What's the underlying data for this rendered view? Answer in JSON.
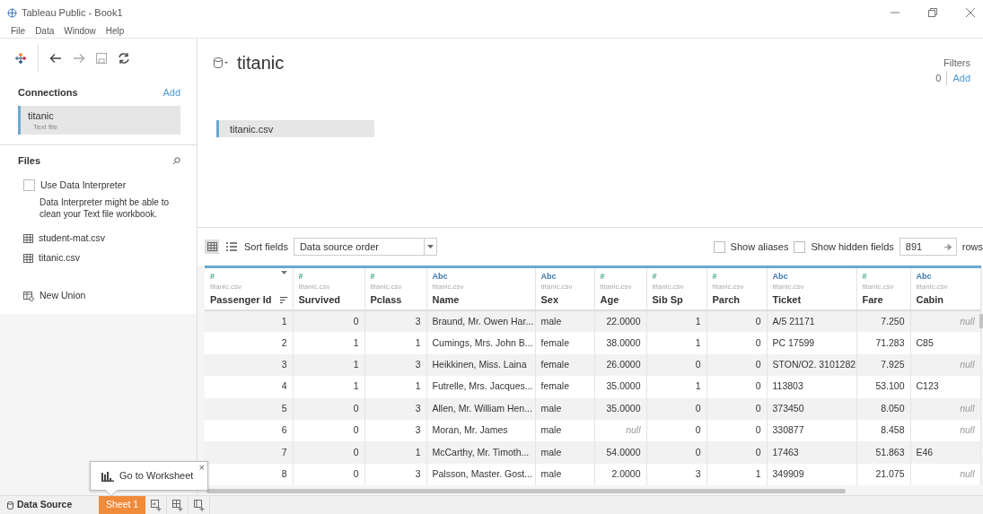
{
  "window": {
    "title": "Tableau Public - Book1"
  },
  "menu": [
    "File",
    "Data",
    "Window",
    "Help"
  ],
  "connections": {
    "title": "Connections",
    "add": "Add",
    "items": [
      {
        "name": "titanic",
        "type": "Text file",
        "selected": true
      }
    ]
  },
  "files": {
    "title": "Files",
    "interpreter": {
      "label": "Use Data Interpreter",
      "checked": false,
      "hint": "Data Interpreter might be able to clean your Text file workbook."
    },
    "items": [
      {
        "name": "student-mat.csv",
        "kind": "table"
      },
      {
        "name": "titanic.csv",
        "kind": "table"
      },
      {
        "name": "New Union",
        "kind": "union"
      }
    ]
  },
  "datasource": {
    "name": "titanic",
    "tables": [
      "titanic.csv"
    ]
  },
  "filters": {
    "label": "Filters",
    "count": "0",
    "add": "Add"
  },
  "grid_toolbar": {
    "views": [
      {
        "kind": "grid",
        "selected": true
      },
      {
        "kind": "list",
        "selected": false
      }
    ],
    "sort_label": "Sort fields",
    "sort_value": "Data source order",
    "show_aliases": {
      "label": "Show aliases",
      "checked": false
    },
    "show_hidden": {
      "label": "Show hidden fields",
      "checked": false
    },
    "row_count": "891",
    "rows_label": "rows"
  },
  "columns": [
    {
      "type_label": "#",
      "kind": "number",
      "source": "titanic.csv",
      "name": "Passenger Id",
      "sorted": true,
      "hovered": true
    },
    {
      "type_label": "#",
      "kind": "number",
      "source": "titanic.csv",
      "name": "Survived",
      "sorted": false,
      "hovered": false
    },
    {
      "type_label": "#",
      "kind": "number",
      "source": "titanic.csv",
      "name": "Pclass",
      "sorted": false,
      "hovered": false
    },
    {
      "type_label": "Abc",
      "kind": "string",
      "source": "titanic.csv",
      "name": "Name",
      "sorted": false,
      "hovered": false
    },
    {
      "type_label": "Abc",
      "kind": "string",
      "source": "titanic.csv",
      "name": "Sex",
      "sorted": false,
      "hovered": false
    },
    {
      "type_label": "#",
      "kind": "number",
      "source": "titanic.csv",
      "name": "Age",
      "sorted": false,
      "hovered": false
    },
    {
      "type_label": "#",
      "kind": "number",
      "source": "titanic.csv",
      "name": "Sib Sp",
      "sorted": false,
      "hovered": false
    },
    {
      "type_label": "#",
      "kind": "number",
      "source": "titanic.csv",
      "name": "Parch",
      "sorted": false,
      "hovered": false
    },
    {
      "type_label": "Abc",
      "kind": "string",
      "source": "titanic.csv",
      "name": "Ticket",
      "sorted": false,
      "hovered": false
    },
    {
      "type_label": "#",
      "kind": "number",
      "source": "titanic.csv",
      "name": "Fare",
      "sorted": false,
      "hovered": false
    },
    {
      "type_label": "Abc",
      "kind": "string",
      "source": "titanic.csv",
      "name": "Cabin",
      "sorted": false,
      "hovered": false
    }
  ],
  "rows": [
    {
      "cells": [
        "1",
        "0",
        "3",
        "Braund, Mr. Owen Har...",
        "male",
        "22.0000",
        "1",
        "0",
        "A/5 21171",
        "7.250",
        {
          "text": "null",
          "kind": "missing"
        }
      ]
    },
    {
      "cells": [
        "2",
        "1",
        "1",
        "Cumings, Mrs. John B...",
        "female",
        "38.0000",
        "1",
        "0",
        "PC 17599",
        "71.283",
        "C85"
      ]
    },
    {
      "cells": [
        "3",
        "1",
        "3",
        "Heikkinen, Miss. Laina",
        "female",
        "26.0000",
        "0",
        "0",
        "STON/O2. 3101282",
        "7.925",
        {
          "text": "null",
          "kind": "missing"
        }
      ]
    },
    {
      "cells": [
        "4",
        "1",
        "1",
        "Futrelle, Mrs. Jacques...",
        "female",
        "35.0000",
        "1",
        "0",
        "113803",
        "53.100",
        "C123"
      ]
    },
    {
      "cells": [
        "5",
        "0",
        "3",
        "Allen, Mr. William Hen...",
        "male",
        "35.0000",
        "0",
        "0",
        "373450",
        "8.050",
        {
          "text": "null",
          "kind": "missing"
        }
      ]
    },
    {
      "cells": [
        "6",
        "0",
        "3",
        "Moran, Mr. James",
        "male",
        {
          "text": "null",
          "kind": "missing"
        },
        "0",
        "0",
        "330877",
        "8.458",
        {
          "text": "null",
          "kind": "missing"
        }
      ]
    },
    {
      "cells": [
        "7",
        "0",
        "1",
        "McCarthy, Mr. Timoth...",
        "male",
        "54.0000",
        "0",
        "0",
        "17463",
        "51.863",
        "E46"
      ]
    },
    {
      "cells": [
        "8",
        "0",
        "3",
        "Palsson, Master. Gost...",
        "male",
        "2.0000",
        "3",
        "1",
        "349909",
        "21.075",
        {
          "text": "null",
          "kind": "missing"
        }
      ]
    }
  ],
  "tooltip": {
    "text": "Go to Worksheet",
    "close": "×"
  },
  "tabs": [
    {
      "label": "Data Source",
      "kind": "datasource",
      "selected": false
    },
    {
      "label": "Sheet 1",
      "kind": "sheet",
      "selected": true
    }
  ]
}
